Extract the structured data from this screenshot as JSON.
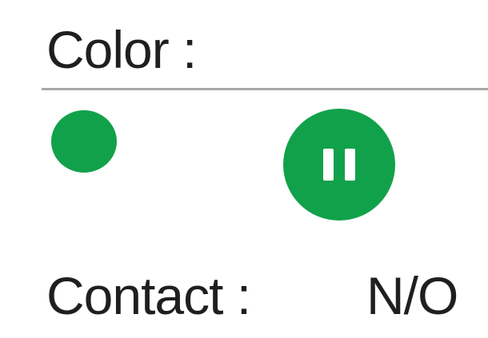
{
  "color_section": {
    "label": "Color :",
    "swatch_color": "#12a14b",
    "swatch_icon": "filled-circle-icon"
  },
  "pause_control": {
    "icon": "pause-icon",
    "color": "#12a14b",
    "glyph_color": "#ffffff"
  },
  "contact_section": {
    "label": "Contact :",
    "value": "N/O"
  },
  "colors": {
    "accent": "#12a14b",
    "divider": "#a8a8a8",
    "text": "#1f1f1f",
    "background": "#ffffff"
  }
}
